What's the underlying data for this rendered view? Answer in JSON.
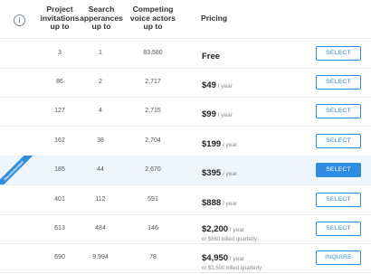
{
  "header": {
    "col1": [
      "Project",
      "invitations",
      "up to"
    ],
    "col2": [
      "Search",
      "apperances",
      "up to"
    ],
    "col3": [
      "Competing",
      "voice actors",
      "up to"
    ],
    "col4": "Pricing",
    "info_icon": "info-icon"
  },
  "rows": [
    {
      "invites": "3",
      "search": "1",
      "competing": "83,580",
      "price": "Free",
      "per": "",
      "sub": "",
      "button": "SELECT",
      "highlight": false
    },
    {
      "invites": "86",
      "search": "2",
      "competing": "2,717",
      "price": "$49",
      "per": " / year",
      "sub": "",
      "button": "SELECT",
      "highlight": false
    },
    {
      "invites": "127",
      "search": "4",
      "competing": "2,715",
      "price": "$99",
      "per": " / year",
      "sub": "",
      "button": "SELECT",
      "highlight": false
    },
    {
      "invites": "162",
      "search": "38",
      "competing": "2,704",
      "price": "$199",
      "per": " / year",
      "sub": "",
      "button": "SELECT",
      "highlight": false
    },
    {
      "invites": "185",
      "search": "44",
      "competing": "2,670",
      "price": "$395",
      "per": " / year",
      "sub": "",
      "button": "SELECT",
      "highlight": true,
      "ribbon": "Recommended"
    },
    {
      "invites": "401",
      "search": "112",
      "competing": "591",
      "price": "$888",
      "per": " / year",
      "sub": "",
      "button": "SELECT",
      "highlight": false
    },
    {
      "invites": "613",
      "search": "484",
      "competing": "146",
      "price": "$2,200",
      "per": " / year",
      "sub": "or $660 billed quarterly",
      "button": "SELECT",
      "highlight": false
    },
    {
      "invites": "690",
      "search": "9,994",
      "competing": "78",
      "price": "$4,950",
      "per": " / year",
      "sub": "or $1,500 billed quarterly",
      "button": "INQUIRE",
      "highlight": false
    }
  ],
  "colors": {
    "accent": "#2f8de4",
    "highlight_row": "#eef5fc",
    "border": "#e5e8ec"
  }
}
